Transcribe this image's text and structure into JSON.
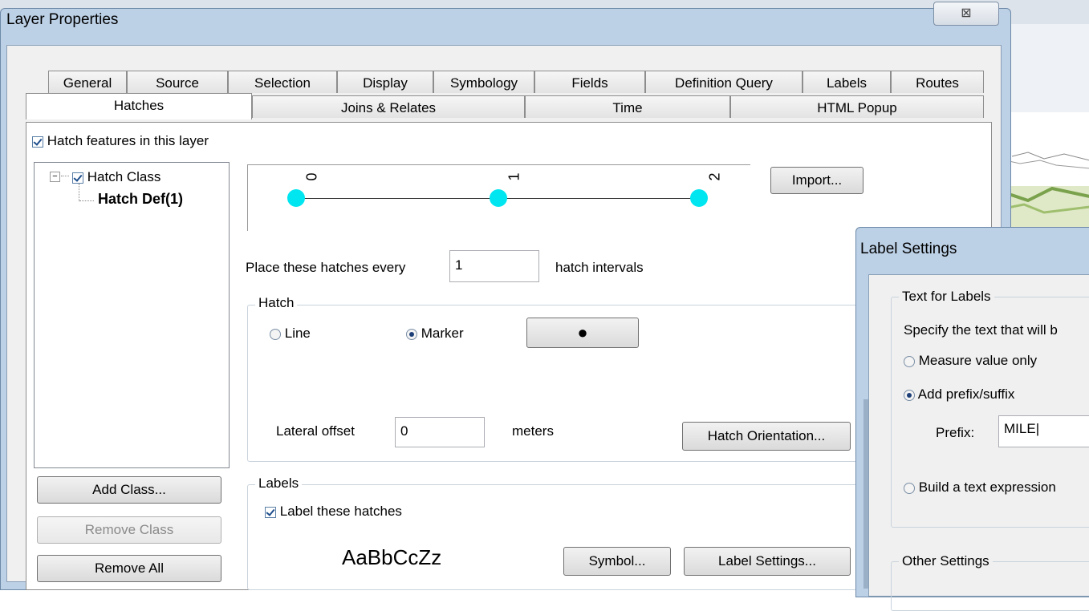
{
  "dialog": {
    "title": "Layer Properties",
    "close_symbol": "⊠"
  },
  "tabs_row1": [
    "General",
    "Source",
    "Selection",
    "Display",
    "Symbology",
    "Fields",
    "Definition Query",
    "Labels",
    "Routes"
  ],
  "tabs_row2": [
    "Hatches",
    "Joins & Relates",
    "Time",
    "HTML Popup"
  ],
  "active_tab": "Hatches",
  "hatch": {
    "enable_label": "Hatch features in this layer",
    "enabled": true,
    "tree": {
      "root_label": "Hatch Class",
      "child_label": "Hatch Def(1)"
    },
    "buttons": {
      "add_class": "Add Class...",
      "remove_class": "Remove Class",
      "remove_all": "Remove All",
      "import": "Import..."
    },
    "ruler_ticks": [
      "0",
      "1",
      "2"
    ],
    "place_prefix": "Place these hatches every",
    "place_value": "1",
    "place_suffix": "hatch intervals",
    "hatch_group": {
      "title": "Hatch",
      "line_label": "Line",
      "marker_label": "Marker",
      "selected": "Marker",
      "marker_symbol": "●",
      "offset_label": "Lateral offset",
      "offset_value": "0",
      "offset_unit": "meters",
      "orientation_button": "Hatch Orientation..."
    },
    "labels_group": {
      "title": "Labels",
      "label_check": "Label these hatches",
      "checked": true,
      "preview": "AaBbCcZz",
      "symbol_button": "Symbol...",
      "settings_button": "Label Settings..."
    }
  },
  "label_settings": {
    "title": "Label Settings",
    "text_group_title": "Text for Labels",
    "specify_text": "Specify the text that will b",
    "opt_measure": "Measure value only",
    "opt_prefix": "Add prefix/suffix",
    "selected": "Add prefix/suffix",
    "prefix_label": "Prefix:",
    "prefix_value": "MILE",
    "opt_expression": "Build a text expression",
    "other_group_title": "Other Settings"
  },
  "colors": {
    "dot": "#00e6f0",
    "frame": "#bcd0e6"
  }
}
